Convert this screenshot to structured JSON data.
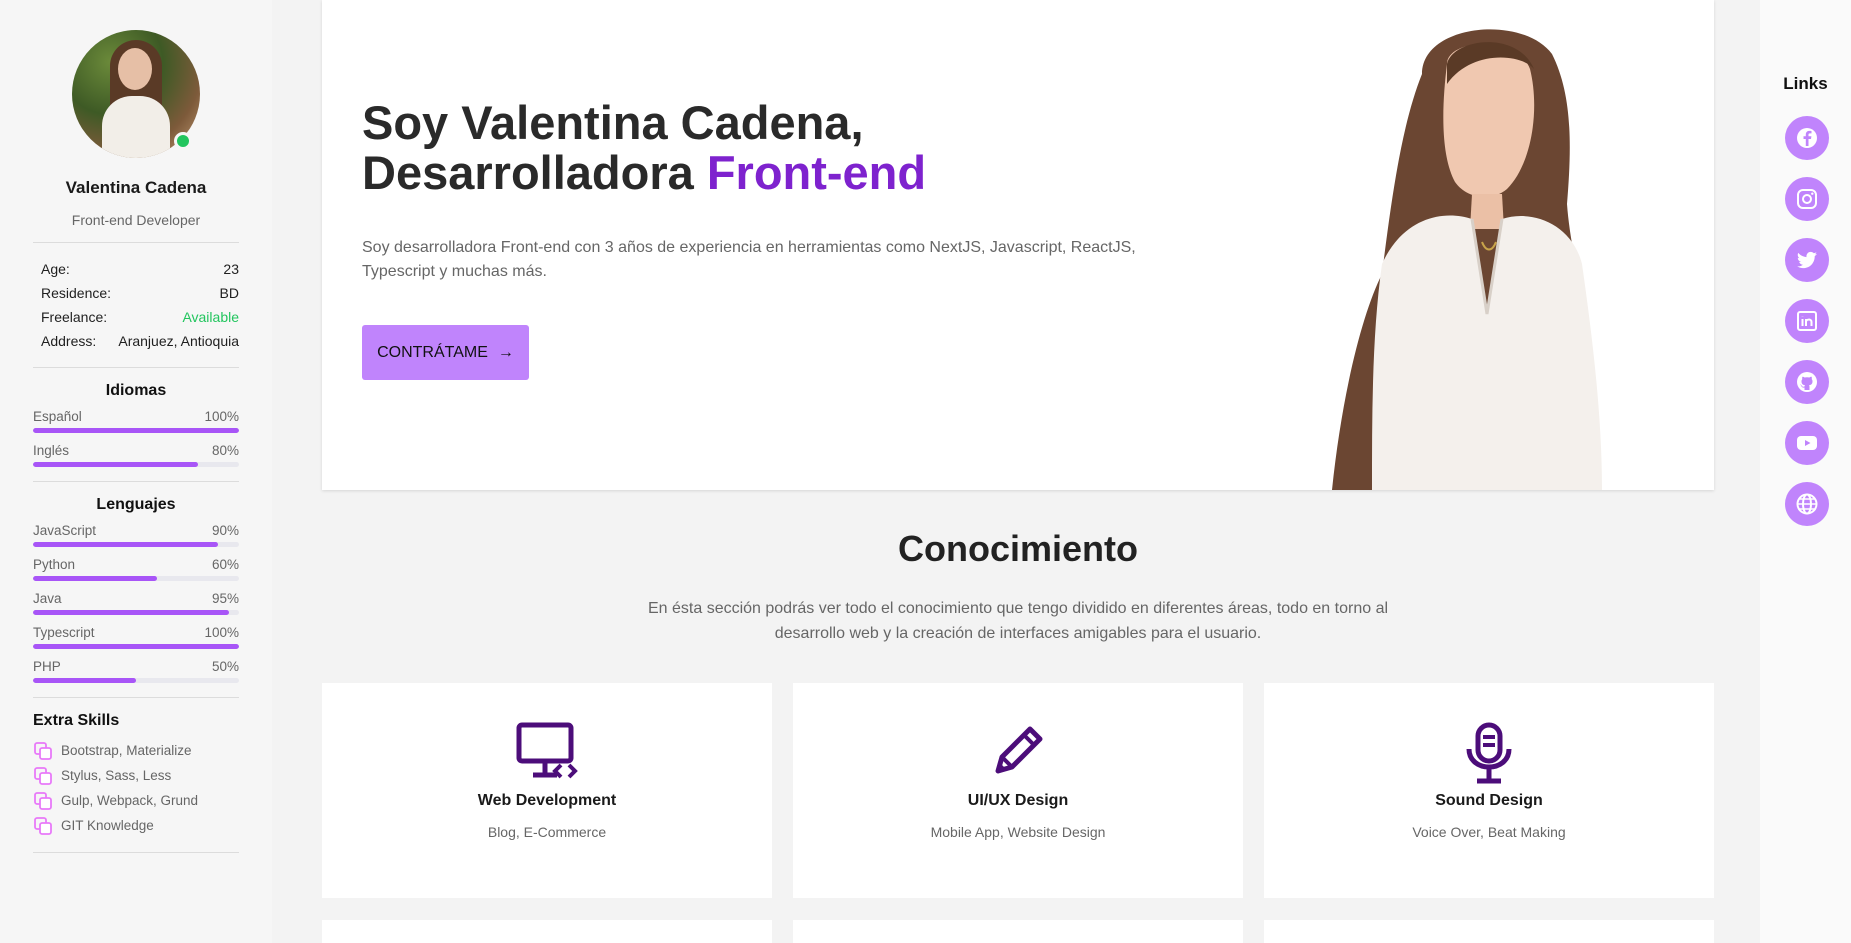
{
  "profile": {
    "name": "Valentina Cadena",
    "role": "Front-end Developer",
    "info": [
      {
        "label": "Age:",
        "value": "23"
      },
      {
        "label": "Residence:",
        "value": "BD"
      },
      {
        "label": "Freelance:",
        "value": "Available"
      },
      {
        "label": "Address:",
        "value": "Aranjuez, Antioquia"
      }
    ]
  },
  "languages": {
    "title": "Idiomas",
    "items": [
      {
        "name": "Español",
        "level": "100%",
        "fraction": 1.0
      },
      {
        "name": "Inglés",
        "level": "80%",
        "fraction": 0.8
      }
    ]
  },
  "programming": {
    "title": "Lenguajes",
    "items": [
      {
        "name": "JavaScript",
        "level": "90%",
        "fraction": 0.9
      },
      {
        "name": "Python",
        "level": "60%",
        "fraction": 0.6
      },
      {
        "name": "Java",
        "level": "95%",
        "fraction": 0.95
      },
      {
        "name": "Typescript",
        "level": "100%",
        "fraction": 1.0
      },
      {
        "name": "PHP",
        "level": "50%",
        "fraction": 0.5
      }
    ]
  },
  "extra": {
    "title": "Extra Skills",
    "items": [
      "Bootstrap, Materialize",
      "Stylus, Sass, Less",
      "Gulp, Webpack, Grund",
      "GIT Knowledge"
    ]
  },
  "hero": {
    "title_line1": "Soy Valentina Cadena,",
    "title_line2_prefix": "Desarrolladora ",
    "title_line2_accent": "Front-end",
    "description": "Soy desarrolladora Front-end con 3 años de experiencia en herramientas como NextJS, Javascript, ReactJS, Typescript y muchas más.",
    "button_label": "CONTRÁTAME",
    "button_arrow": "→"
  },
  "knowledge": {
    "title": "Conocimiento",
    "description": "En ésta sección podrás ver todo el conocimiento que tengo dividido en diferentes áreas, todo en torno al desarrollo web y la creación de interfaces amigables para el usuario.",
    "cards": [
      {
        "title": "Web Development",
        "subtitle": "Blog, E-Commerce",
        "icon": "monitor-code-icon"
      },
      {
        "title": "UI/UX Design",
        "subtitle": "Mobile App, Website Design",
        "icon": "pencil-icon"
      },
      {
        "title": "Sound Design",
        "subtitle": "Voice Over, Beat Making",
        "icon": "microphone-icon"
      }
    ]
  },
  "links": {
    "title": "Links",
    "items": [
      "facebook-icon",
      "instagram-icon",
      "twitter-icon",
      "linkedin-icon",
      "github-icon",
      "youtube-icon",
      "globe-icon"
    ]
  },
  "colors": {
    "accent": "#7e22ce",
    "button": "#c084fc",
    "bar": "#a855f7",
    "icon_dark": "#4c0d7a",
    "available": "#22c55e"
  }
}
